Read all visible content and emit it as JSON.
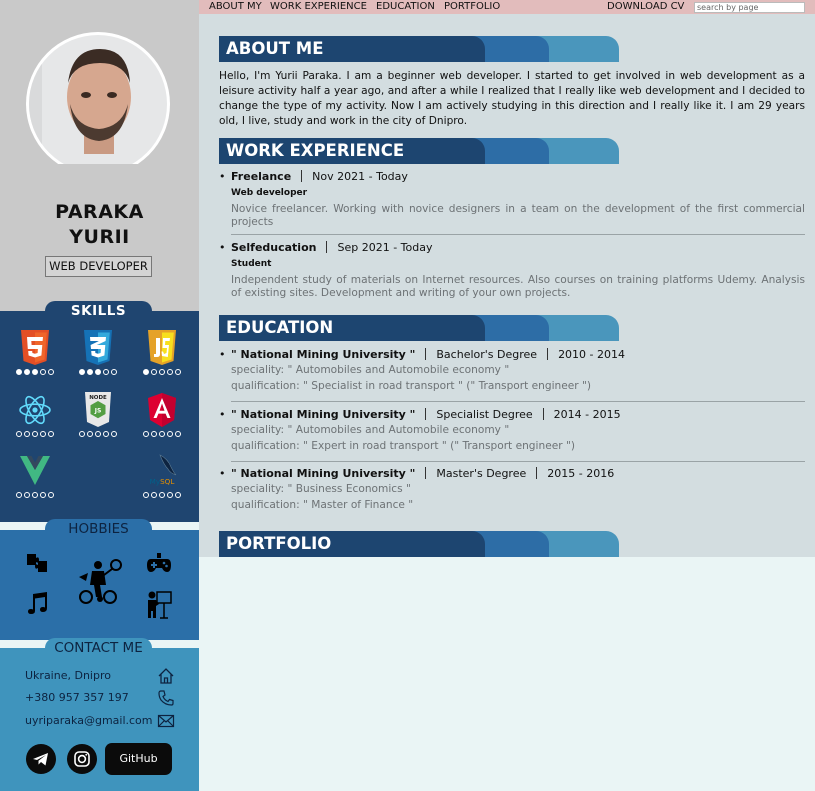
{
  "profile": {
    "first_line": "PARAKA",
    "second_line": "YURII",
    "role": "WEB DEVELOPER"
  },
  "skills": {
    "title": "SKILLS",
    "items": [
      {
        "icon": "html5-icon",
        "level": 3
      },
      {
        "icon": "css3-icon",
        "level": 3
      },
      {
        "icon": "javascript-icon",
        "level": 1
      },
      {
        "icon": "react-icon",
        "level": 0
      },
      {
        "icon": "nodejs-icon",
        "level": 0
      },
      {
        "icon": "angular-icon",
        "level": 0
      },
      {
        "icon": "vue-icon",
        "level": 0
      },
      {
        "icon": "mysql-icon",
        "level": 0
      }
    ]
  },
  "hobbies": {
    "title": "HOBBIES",
    "icons": [
      "puzzle-icon",
      "gamepad-icon",
      "music-icon",
      "sports-icon",
      "teaching-icon"
    ]
  },
  "contact": {
    "title": "CONTACT ME",
    "location": "Ukraine, Dnipro",
    "phone": "+380 957 357 197",
    "email": "uyriparaka@gmail.com",
    "github_label": "GitHub",
    "socials": [
      "telegram-icon",
      "instagram-icon"
    ]
  },
  "nav": {
    "items": [
      "ABOUT MY",
      "WORK EXPERIENCE",
      "EDUCATION",
      "PORTFOLIO"
    ],
    "download": "DOWNLOAD CV",
    "search_placeholder": "search by page"
  },
  "about": {
    "title": "ABOUT ME",
    "text": "Hello, I'm Yurii Paraka. I am a beginner web developer. I started to get involved in web development as a leisure activity half a year ago, and after a while I realized that I really like web development and I decided to change the type of my activity. Now I am actively studying in this direction and I really like it. I am 29 years old, I live, study and work in the city of Dnipro."
  },
  "work": {
    "title": "WORK EXPERIENCE",
    "items": [
      {
        "company": "Freelance",
        "period": "Nov 2021 - Today",
        "position": "Web developer",
        "description": "Novice freelancer. Working with novice designers in a team on the development of the first commercial projects"
      },
      {
        "company": "Selfeducation",
        "period": "Sep 2021 - Today",
        "position": "Student",
        "description": "Independent study of materials on Internet resources. Also courses on training platforms Udemy. Analysis of existing sites. Development and writing of your own projects."
      }
    ]
  },
  "education": {
    "title": "EDUCATION",
    "items": [
      {
        "school": "\" National Mining University \"",
        "degree": "Bachelor's Degree",
        "period": "2010 - 2014",
        "speciality": "speciality: \" Automobiles and Automobile economy \"",
        "qualification": "qualification: \" Specialist in road transport \" (\" Transport engineer \")"
      },
      {
        "school": "\" National Mining University \"",
        "degree": "Specialist Degree",
        "period": "2014 - 2015",
        "speciality": "speciality: \" Automobiles and Automobile economy \"",
        "qualification": "qualification: \" Expert in road transport \" (\" Transport engineer \")"
      },
      {
        "school": "\" National Mining University \"",
        "degree": "Master's Degree",
        "period": "2015 - 2016",
        "speciality": "speciality: \" Business Economics \"",
        "qualification": "qualification: \" Master of Finance \""
      }
    ]
  },
  "portfolio": {
    "title": "PORTFOLIO"
  },
  "colors": {
    "sidebar_top": "#c9c9c9",
    "skills_bg": "#1f4570",
    "hobbies_bg": "#2b6fa8",
    "contact_bg": "#3f94bd",
    "nav_bg": "#e2bcbc",
    "main_bg": "#d3dde0"
  }
}
